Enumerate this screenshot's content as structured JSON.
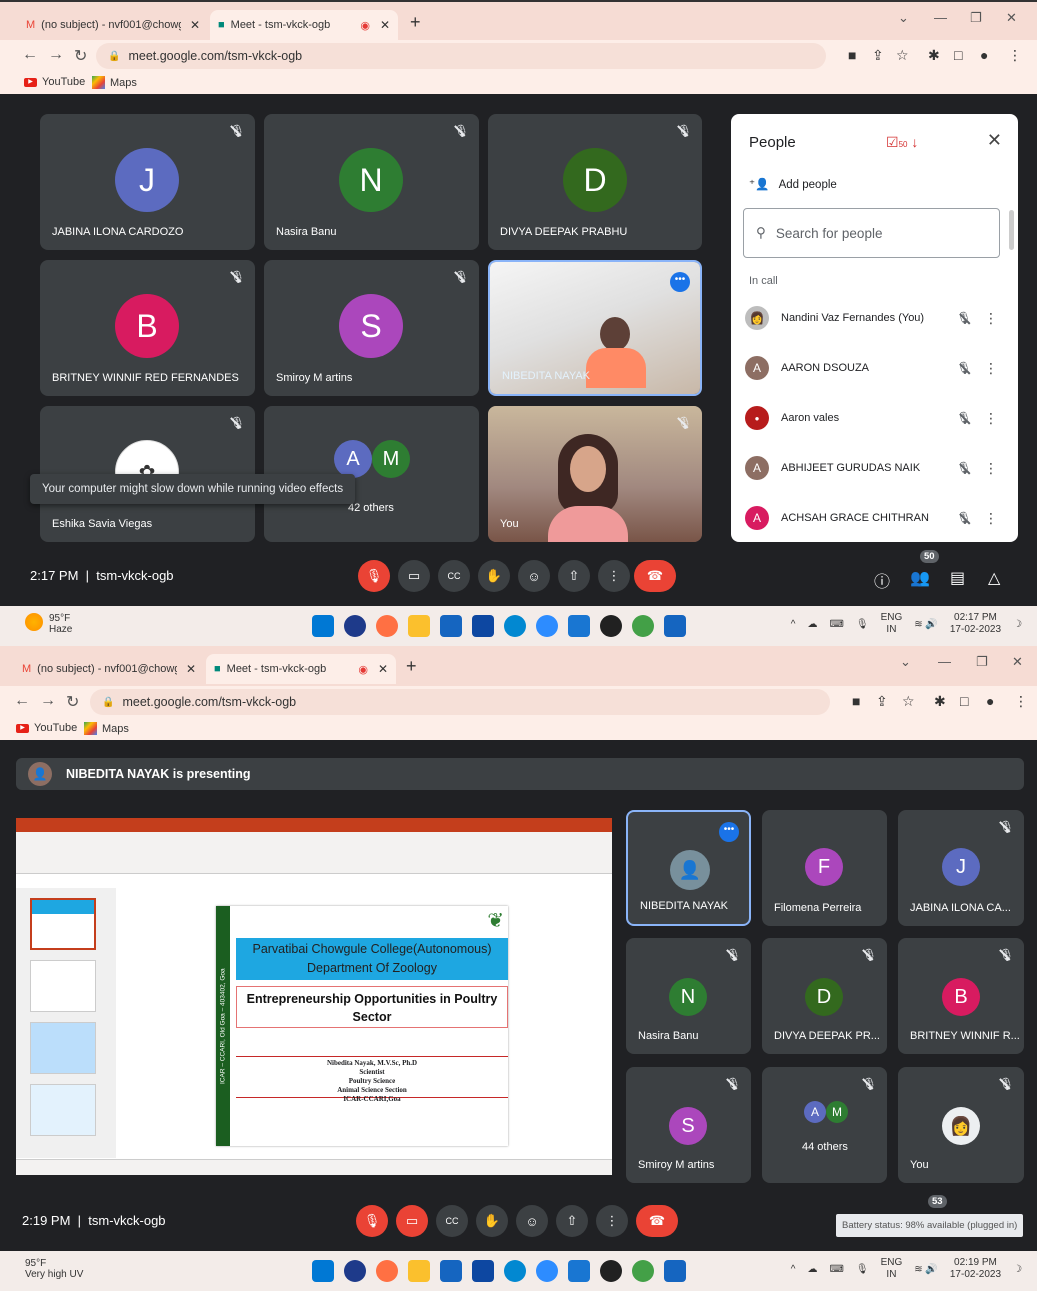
{
  "shot1": {
    "tabs": [
      {
        "label": "(no subject) - nvf001@chowgule"
      },
      {
        "label": "Meet - tsm-vkck-ogb"
      }
    ],
    "url": "meet.google.com/tsm-vkck-ogb",
    "bookmarks": [
      "YouTube",
      "Maps"
    ],
    "tiles": [
      {
        "name": "JABINA ILONA CARDOZO",
        "initial": "J",
        "color": "#5c6bc0"
      },
      {
        "name": "Nasira Banu",
        "initial": "N",
        "color": "#2e7d32"
      },
      {
        "name": "DIVYA DEEPAK PRABHU",
        "initial": "D",
        "color": "#33691e"
      },
      {
        "name": "BRITNEY WINNIF RED FERNANDES",
        "initial": "B",
        "color": "#d81b60"
      },
      {
        "name": "Smiroy M artins",
        "initial": "S",
        "color": "#ab47bc"
      },
      {
        "name": "NIBEDITA NAYAK"
      },
      {
        "name": "Eshika Savia Viegas"
      },
      {
        "name": "42 others",
        "a": "A",
        "m": "M"
      },
      {
        "name": "You"
      }
    ],
    "tooltip": "Your computer might slow down while running video effects",
    "clock": "2:17 PM",
    "meeting_code": "tsm-vkck-ogb",
    "people_badge": "50",
    "panel": {
      "title": "People",
      "count": "50",
      "add_people": "Add people",
      "search_placeholder": "Search for people",
      "in_call": "In call",
      "people": [
        {
          "name": "Nandini Vaz Fernandes (You)",
          "initial": "",
          "color": "#bdbdbd"
        },
        {
          "name": "AARON DSOUZA",
          "initial": "A",
          "color": "#8d6e63"
        },
        {
          "name": "Aaron vales",
          "initial": "",
          "color": "#b71c1c"
        },
        {
          "name": "ABHIJEET GURUDAS NAIK",
          "initial": "A",
          "color": "#8d6e63"
        },
        {
          "name": "ACHSAH GRACE CHITHRAN",
          "initial": "A",
          "color": "#d81b60"
        }
      ]
    },
    "taskbar": {
      "temp": "95°F",
      "weather": "Haze",
      "lang": "ENG",
      "region": "IN",
      "time": "02:17 PM",
      "date": "17-02-2023"
    }
  },
  "shot2": {
    "tabs": [
      {
        "label": "(no subject) - nvf001@chowgule"
      },
      {
        "label": "Meet - tsm-vkck-ogb"
      }
    ],
    "url": "meet.google.com/tsm-vkck-ogb",
    "bookmarks": [
      "YouTube",
      "Maps"
    ],
    "presenting": "NIBEDITA NAYAK is presenting",
    "slide": {
      "side_text": "ICAR – CCARI, Old Goa – 403402, Goa",
      "college": "Parvatibai Chowgule College(Autonomous)",
      "dept": "Department Of Zoology",
      "title": "Entrepreneurship Opportunities in Poultry Sector",
      "author_lines": [
        "Nibedita Nayak, M.V.Sc, Ph.D",
        "Scientist",
        "Poultry Science",
        "Animal Science Section",
        "ICAR-CCARI,Goa"
      ]
    },
    "tiles": [
      {
        "name": "NIBEDITA NAYAK"
      },
      {
        "name": "Filomena Perreira",
        "initial": "F",
        "color": "#ab47bc"
      },
      {
        "name": "JABINA ILONA CA...",
        "initial": "J",
        "color": "#5c6bc0"
      },
      {
        "name": "Nasira Banu",
        "initial": "N",
        "color": "#2e7d32"
      },
      {
        "name": "DIVYA DEEPAK PR...",
        "initial": "D",
        "color": "#33691e"
      },
      {
        "name": "BRITNEY WINNIF R...",
        "initial": "B",
        "color": "#d81b60"
      },
      {
        "name": "Smiroy M artins",
        "initial": "S",
        "color": "#ab47bc"
      },
      {
        "name": "44 others",
        "a": "A",
        "m": "M"
      },
      {
        "name": "You"
      }
    ],
    "clock": "2:19 PM",
    "meeting_code": "tsm-vkck-ogb",
    "people_badge": "53",
    "battery_tip": "Battery status: 98% available (plugged in)",
    "taskbar": {
      "temp": "95°F",
      "weather": "Very high UV",
      "lang": "ENG",
      "region": "IN",
      "time": "02:19 PM",
      "date": "17-02-2023"
    }
  },
  "icons": {
    "mic_off": "microphone-off-icon",
    "camera": "camera-icon",
    "captions": "cc-icon",
    "hand": "raise-hand-icon",
    "emoji": "emoji-icon",
    "present": "present-icon",
    "more": "more-vert-icon",
    "hangup": "hangup-icon",
    "info": "info-icon",
    "people": "people-icon",
    "chat": "chat-icon",
    "activities": "activities-icon"
  }
}
